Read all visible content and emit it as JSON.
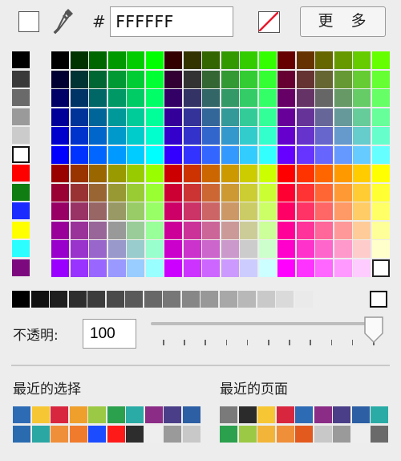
{
  "hex_prefix": "#",
  "hex_value": "FFFFFF",
  "more_button": "更 多",
  "opacity_label": "不透明:",
  "opacity_value": "100",
  "recent_selection_label": "最近的选择",
  "recent_page_label": "最近的页面",
  "slider_level_percent": 100,
  "left_column_colors": [
    "#000000",
    "#3a3a3a",
    "#6a6a6a",
    "#9a9a9a",
    "#cbcbcb",
    "#ffffff",
    "#ff0000",
    "#0f7d12",
    "#1a2cff",
    "#ffff00",
    "#2cfeff",
    "#7c0a7e"
  ],
  "gray_row_colors": [
    "#000000",
    "#111111",
    "#1e1e1e",
    "#2e2e2e",
    "#3c3c3c",
    "#4a4a4a",
    "#5a5a5a",
    "#686868",
    "#777777",
    "#878787",
    "#989898",
    "#a8a8a8",
    "#b8b8b8",
    "#c9c9c9",
    "#dadada",
    "#eaeaea",
    "#ffffff"
  ],
  "recent_selection_colors": [
    [
      "#2e6bb5",
      "#f7c634",
      "#d9263f",
      "#ef9f2c",
      "#9cc945",
      "#2ba04d",
      "#2aaba5",
      "#8b2c86",
      "#4a3e88",
      "#2c5fa4"
    ],
    [
      "#2a6bb0",
      "#2aa6a3",
      "#ef8f3a",
      "#f07b2d",
      "#1c4cff",
      "#ff1a1a",
      "#2d2d2d",
      "#eeeeee",
      "#9a9a9a",
      "#c8c8c8"
    ]
  ],
  "recent_page_colors": [
    [
      "#7a7a7a",
      "#2b2b2b",
      "#f7c634",
      "#d9263f",
      "#2e6bb5",
      "#8b2c86",
      "#4a3e88",
      "#2c5fa4",
      "#2aaba5"
    ],
    [
      "#2ba04d",
      "#9cc945",
      "#f2b53a",
      "#ef8f3a",
      "#e35a1f",
      "#c8c8c8",
      "#9a9a9a",
      "#eeeeee",
      "#6a6a6a"
    ]
  ]
}
